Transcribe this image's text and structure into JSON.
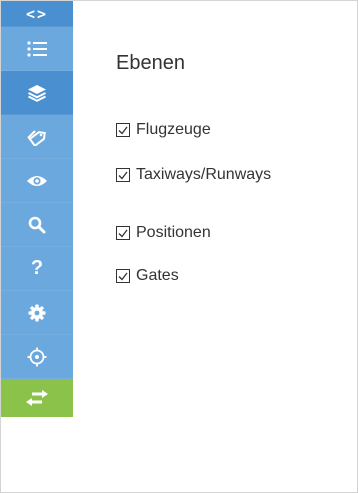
{
  "colors": {
    "sidebar_active": "#4a90d0",
    "sidebar_item": "#6aa8dd",
    "sidebar_current": "#5a9dd6",
    "sidebar_green": "#8bc34a",
    "icon": "#ffffff",
    "text": "#333333"
  },
  "sidebar": {
    "items": [
      {
        "name": "collapse",
        "icon": "code-chevrons-icon",
        "glyph": "<>"
      },
      {
        "name": "list",
        "icon": "list-icon"
      },
      {
        "name": "layers",
        "icon": "layers-icon",
        "active": true
      },
      {
        "name": "tags",
        "icon": "tag-icon"
      },
      {
        "name": "visibility",
        "icon": "eye-icon"
      },
      {
        "name": "search",
        "icon": "search-icon"
      },
      {
        "name": "help",
        "icon": "question-icon",
        "glyph": "?"
      },
      {
        "name": "settings",
        "icon": "gear-icon"
      },
      {
        "name": "locate",
        "icon": "crosshair-icon"
      },
      {
        "name": "swap",
        "icon": "swap-arrows-icon"
      }
    ]
  },
  "panel": {
    "title": "Ebenen",
    "layers": [
      {
        "label": "Flugzeuge",
        "checked": true
      },
      {
        "label": "Taxiways/Runways",
        "checked": true
      },
      {
        "label": "Positionen",
        "checked": true
      },
      {
        "label": "Gates",
        "checked": true
      }
    ]
  }
}
